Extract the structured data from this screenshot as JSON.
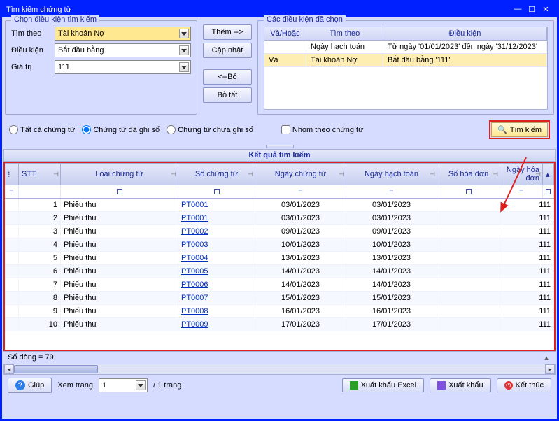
{
  "title": "Tìm kiếm chứng từ",
  "groups": {
    "searchCond": "Chọn điều kiện tìm kiếm",
    "chosenCond": "Các điều kiện đã chọn"
  },
  "labels": {
    "timTheo": "Tìm theo",
    "dieuKien": "Điều kiện",
    "giaTri": "Giá trị"
  },
  "values": {
    "timTheo": "Tài khoản Nợ",
    "dieuKien": "Bắt đầu bằng",
    "giaTri": "111"
  },
  "buttons": {
    "them": "Thêm -->",
    "capNhat": "Cập nhật",
    "bo": "<--Bỏ",
    "boTat": "Bỏ tất"
  },
  "condTable": {
    "h1": "Và/Hoặc",
    "h2": "Tìm theo",
    "h3": "Điều kiện",
    "rows": [
      {
        "a": "",
        "b": "Ngày hạch toán",
        "c": "Từ ngày '01/01/2023' đến ngày '31/12/2023'"
      },
      {
        "a": "Và",
        "b": "Tài khoản Nợ",
        "c": "Bắt đầu bằng '111'"
      }
    ]
  },
  "radios": {
    "all": "Tất cả chứng từ",
    "recorded": "Chứng từ đã ghi sổ",
    "notRecorded": "Chứng từ chưa ghi sổ"
  },
  "groupByDoc": "Nhóm theo chứng từ",
  "searchBtn": "Tìm kiếm",
  "resultsHeader": "Kết quả tìm kiếm",
  "cols": {
    "stt": "STT",
    "loai": "Loại chứng từ",
    "so": "Số chứng từ",
    "ngayCt": "Ngày chứng từ",
    "ngayHt": "Ngày hạch toán",
    "soHd": "Số hóa đơn",
    "ngayHd": "Ngày hóa đơn"
  },
  "rows": [
    {
      "stt": "1",
      "loai": "Phiếu thu",
      "so": "PT0001",
      "nct": "03/01/2023",
      "nht": "03/01/2023",
      "last": "111"
    },
    {
      "stt": "2",
      "loai": "Phiếu thu",
      "so": "PT0001",
      "nct": "03/01/2023",
      "nht": "03/01/2023",
      "last": "111"
    },
    {
      "stt": "3",
      "loai": "Phiếu thu",
      "so": "PT0002",
      "nct": "09/01/2023",
      "nht": "09/01/2023",
      "last": "111"
    },
    {
      "stt": "4",
      "loai": "Phiếu thu",
      "so": "PT0003",
      "nct": "10/01/2023",
      "nht": "10/01/2023",
      "last": "111"
    },
    {
      "stt": "5",
      "loai": "Phiếu thu",
      "so": "PT0004",
      "nct": "13/01/2023",
      "nht": "13/01/2023",
      "last": "111"
    },
    {
      "stt": "6",
      "loai": "Phiếu thu",
      "so": "PT0005",
      "nct": "14/01/2023",
      "nht": "14/01/2023",
      "last": "111"
    },
    {
      "stt": "7",
      "loai": "Phiếu thu",
      "so": "PT0006",
      "nct": "14/01/2023",
      "nht": "14/01/2023",
      "last": "111"
    },
    {
      "stt": "8",
      "loai": "Phiếu thu",
      "so": "PT0007",
      "nct": "15/01/2023",
      "nht": "15/01/2023",
      "last": "111"
    },
    {
      "stt": "9",
      "loai": "Phiếu thu",
      "so": "PT0008",
      "nct": "16/01/2023",
      "nht": "16/01/2023",
      "last": "111"
    },
    {
      "stt": "10",
      "loai": "Phiếu thu",
      "so": "PT0009",
      "nct": "17/01/2023",
      "nht": "17/01/2023",
      "last": "111"
    }
  ],
  "status": "Số dòng = 79",
  "footer": {
    "help": "Giúp",
    "viewPage": "Xem trang",
    "pageNum": "1",
    "pageTotal": "/ 1 trang",
    "exportExcel": "Xuất khẩu Excel",
    "export": "Xuất khẩu",
    "close": "Kết thúc"
  }
}
